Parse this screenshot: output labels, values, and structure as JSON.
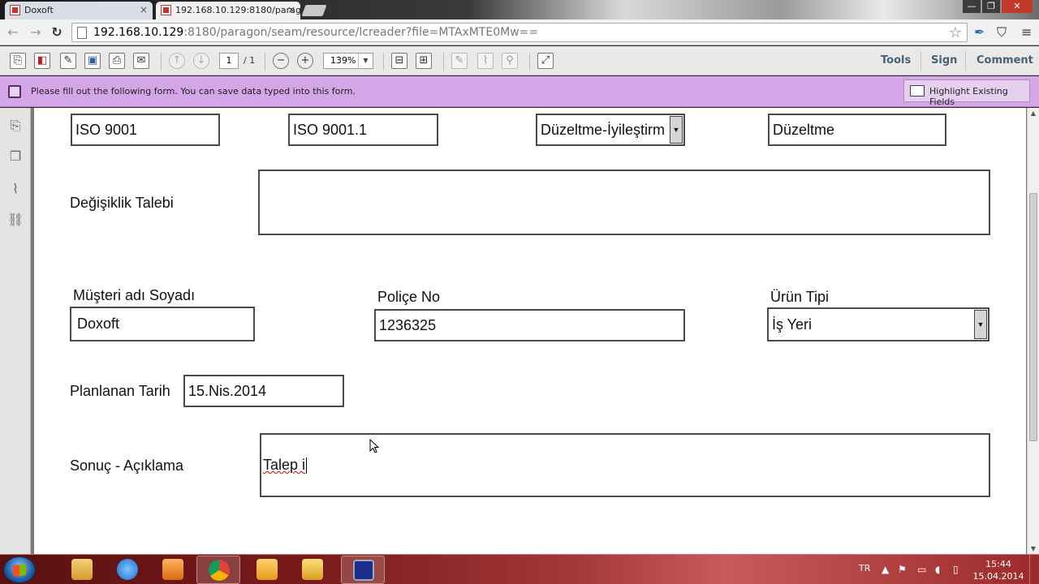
{
  "browser": {
    "tabs": [
      {
        "title": "Doxoft",
        "active": false
      },
      {
        "title": "192.168.10.129:8180/parag",
        "active": true
      }
    ],
    "url_host": "192.168.10.129",
    "url_rest": ":8180/paragon/seam/resource/lcreader?file=MTAxMTE0Mw=="
  },
  "pdf_toolbar": {
    "page_current": "1",
    "page_total": "/ 1",
    "zoom": "139%",
    "links": {
      "tools": "Tools",
      "sign": "Sign",
      "comment": "Comment"
    }
  },
  "form_bar": {
    "message": "Please fill out the following form. You can save data typed into this form.",
    "highlight_button": "Highlight Existing Fields"
  },
  "form": {
    "row1": {
      "field1": "ISO 9001",
      "field2": "ISO 9001.1",
      "select1": "Düzeltme-İyileştirm",
      "field4": "Düzeltme"
    },
    "change_request": {
      "label": "Değişiklik Talebi",
      "value": ""
    },
    "customer": {
      "label": "Müşteri adı Soyadı",
      "value": "Doxoft"
    },
    "policy": {
      "label": "Poliçe No",
      "value": "1236325"
    },
    "product_type": {
      "label": "Ürün Tipi",
      "value": "İş Yeri"
    },
    "planned_date": {
      "label": "Planlanan Tarih",
      "value": "15.Nis.2014"
    },
    "result": {
      "label": "Sonuç - Açıklama",
      "value": "Talep i"
    }
  },
  "taskbar": {
    "language": "TR",
    "time": "15:44",
    "date": "15.04.2014"
  },
  "colors": {
    "form_bar": "#d4a6e8",
    "taskbar": "#7a1a1a",
    "toolbar_link": "#4a6173"
  }
}
